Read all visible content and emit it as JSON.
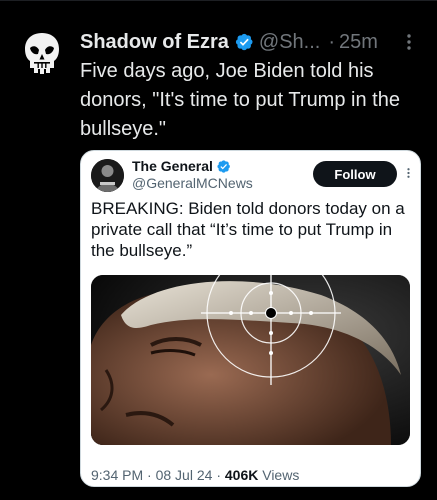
{
  "tweet": {
    "display_name": "Shadow of Ezra",
    "handle": "@Sh...",
    "separator": "·",
    "time": "25m",
    "text": "Five days ago, Joe Biden told his donors, \"It's time to put Trump in the bullseye.\"",
    "avatar_icon": "punisher-skull-icon",
    "verified_icon": "verified-badge-icon",
    "more_icon": "more-options-icon"
  },
  "quote": {
    "display_name": "The General",
    "handle": "@GeneralMCNews",
    "follow_label": "Follow",
    "text": "BREAKING: Biden told donors today on a private call that “It’s time to put Trump in the bullseye.”",
    "time": "9:34 PM",
    "date": "08 Jul 24",
    "views_count": "406K",
    "views_label": "Views",
    "meta_sep": "·"
  },
  "colors": {
    "background": "#000000",
    "verified": "#1d9bf0",
    "muted": "#71767b"
  }
}
